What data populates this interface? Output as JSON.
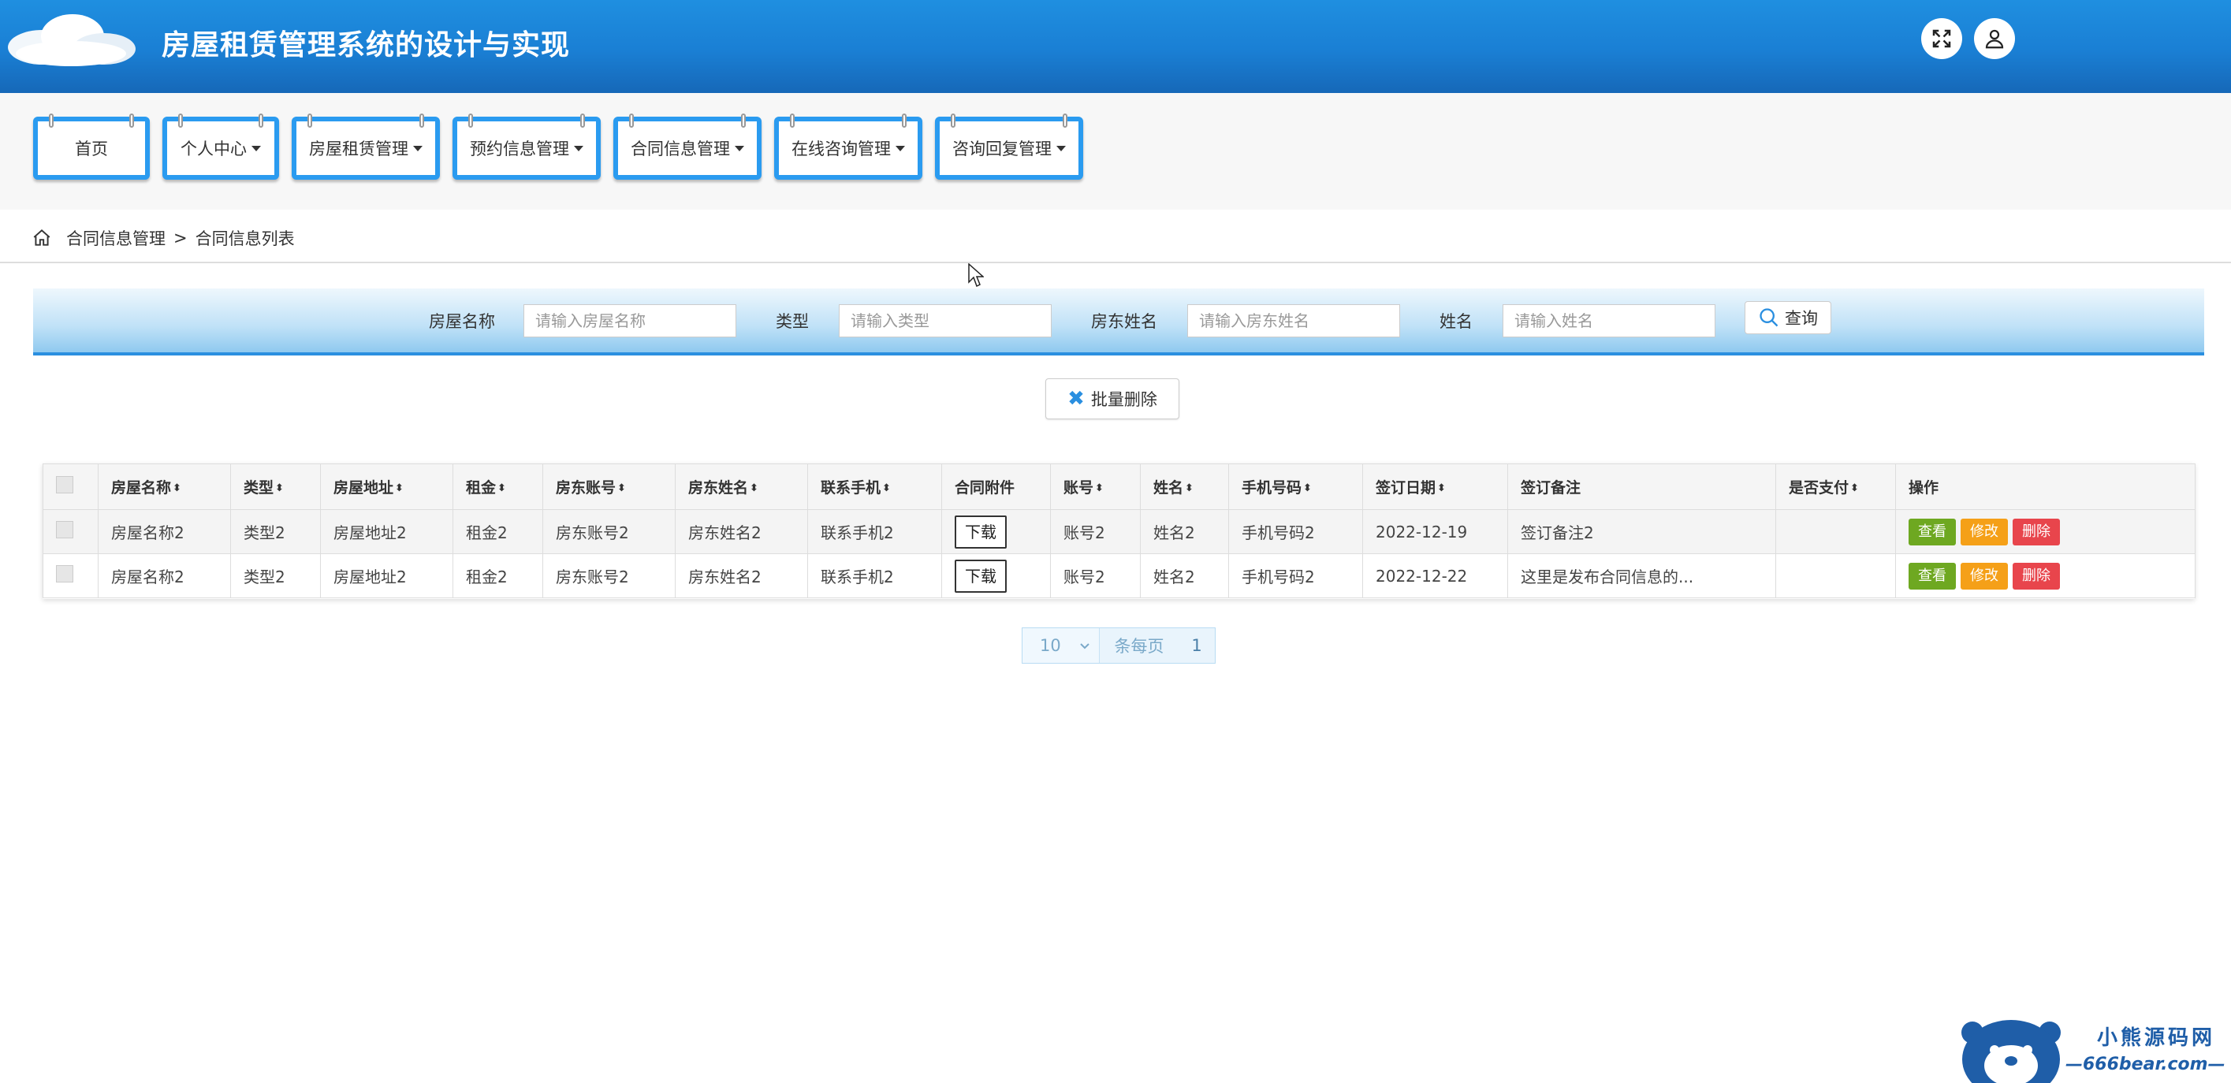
{
  "header": {
    "title": "房屋租赁管理系统的设计与实现",
    "fullscreen_icon": "expand-icon",
    "user_icon": "user-icon"
  },
  "nav": {
    "items": [
      {
        "label": "首页",
        "has_dropdown": false
      },
      {
        "label": "个人中心",
        "has_dropdown": true
      },
      {
        "label": "房屋租赁管理",
        "has_dropdown": true
      },
      {
        "label": "预约信息管理",
        "has_dropdown": true
      },
      {
        "label": "合同信息管理",
        "has_dropdown": true
      },
      {
        "label": "在线咨询管理",
        "has_dropdown": true
      },
      {
        "label": "咨询回复管理",
        "has_dropdown": true
      }
    ]
  },
  "breadcrumb": {
    "home_icon": "home-icon",
    "level1": "合同信息管理",
    "separator": ">",
    "level2": "合同信息列表"
  },
  "search": {
    "fields": [
      {
        "label": "房屋名称",
        "placeholder": "请输入房屋名称"
      },
      {
        "label": "类型",
        "placeholder": "请输入类型"
      },
      {
        "label": "房东姓名",
        "placeholder": "请输入房东姓名"
      },
      {
        "label": "姓名",
        "placeholder": "请输入姓名"
      }
    ],
    "button_label": "查询"
  },
  "batch_delete": {
    "label": "批量删除"
  },
  "table": {
    "headers": [
      "房屋名称",
      "类型",
      "房屋地址",
      "租金",
      "房东账号",
      "房东姓名",
      "联系手机",
      "合同附件",
      "账号",
      "姓名",
      "手机号码",
      "签订日期",
      "签订备注",
      "是否支付",
      "操作"
    ],
    "rows": [
      {
        "name": "房屋名称2",
        "type": "类型2",
        "address": "房屋地址2",
        "rent": "租金2",
        "landlord_account": "房东账号2",
        "landlord_name": "房东姓名2",
        "phone": "联系手机2",
        "attachment": "下载",
        "account": "账号2",
        "person": "姓名2",
        "mobile": "手机号码2",
        "date": "2022-12-19",
        "remark": "签订备注2",
        "paid": ""
      },
      {
        "name": "房屋名称2",
        "type": "类型2",
        "address": "房屋地址2",
        "rent": "租金2",
        "landlord_account": "房东账号2",
        "landlord_name": "房东姓名2",
        "phone": "联系手机2",
        "attachment": "下载",
        "account": "账号2",
        "person": "姓名2",
        "mobile": "手机号码2",
        "date": "2022-12-22",
        "remark": "这里是发布合同信息的...",
        "paid": ""
      }
    ],
    "actions": {
      "view": "查看",
      "edit": "修改",
      "delete": "删除"
    },
    "sort_glyph": "⬍"
  },
  "pagination": {
    "page_size": "10",
    "page_size_label": "条每页",
    "current_page": "1"
  },
  "watermark": {
    "title": "小熊源码网",
    "url": "—666bear.com—"
  },
  "colors": {
    "header_blue": "#1a7fd4",
    "nav_border": "#2a9bf0",
    "view_green": "#6ea821",
    "edit_orange": "#f5a018",
    "delete_red": "#e8454c"
  }
}
